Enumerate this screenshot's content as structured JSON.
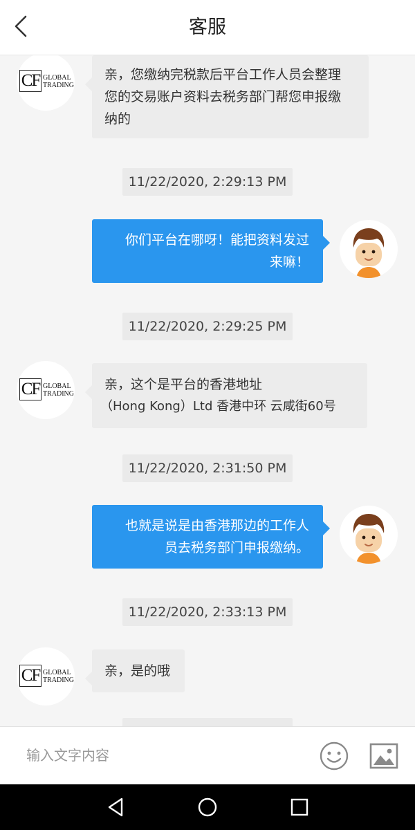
{
  "header": {
    "title": "客服",
    "back_icon": "chevron-left-icon"
  },
  "messages": [
    {
      "side": "left",
      "lines": [
        "亲，您缴纳完税款后平台工作人员会整理",
        "您的交易账户资料去税务部门帮您申报缴",
        "纳的"
      ]
    },
    {
      "type": "time",
      "text": "11/22/2020, 2:29:13 PM"
    },
    {
      "side": "right",
      "lines": [
        "你们平台在哪呀！能把资料发过",
        "来嘛！"
      ]
    },
    {
      "type": "time",
      "text": "11/22/2020, 2:29:25 PM"
    },
    {
      "side": "left",
      "lines": [
        "亲，这个是平台的香港地址",
        "（Hong Kong）Ltd 香港中环 云咸街60号"
      ]
    },
    {
      "type": "time",
      "text": "11/22/2020, 2:31:50 PM"
    },
    {
      "side": "right",
      "lines": [
        "也就是说是由香港那边的工作人",
        "员去税务部门申报缴纳。"
      ]
    },
    {
      "type": "time",
      "text": "11/22/2020, 2:33:13 PM"
    },
    {
      "side": "left",
      "lines": [
        "亲，是的哦"
      ]
    }
  ],
  "logo": {
    "mark": "CF",
    "line1": "GLOBAL",
    "line2": "TRADING"
  },
  "input": {
    "placeholder": "输入文字内容"
  },
  "icons": {
    "emoji": "smiley-icon",
    "image": "image-icon"
  },
  "navbar": {
    "back": "triangle-back-icon",
    "home": "circle-home-icon",
    "recent": "square-recents-icon"
  },
  "colors": {
    "bubble_self": "#2a96ee",
    "bubble_other": "#ececec",
    "background": "#f5f5f5"
  }
}
